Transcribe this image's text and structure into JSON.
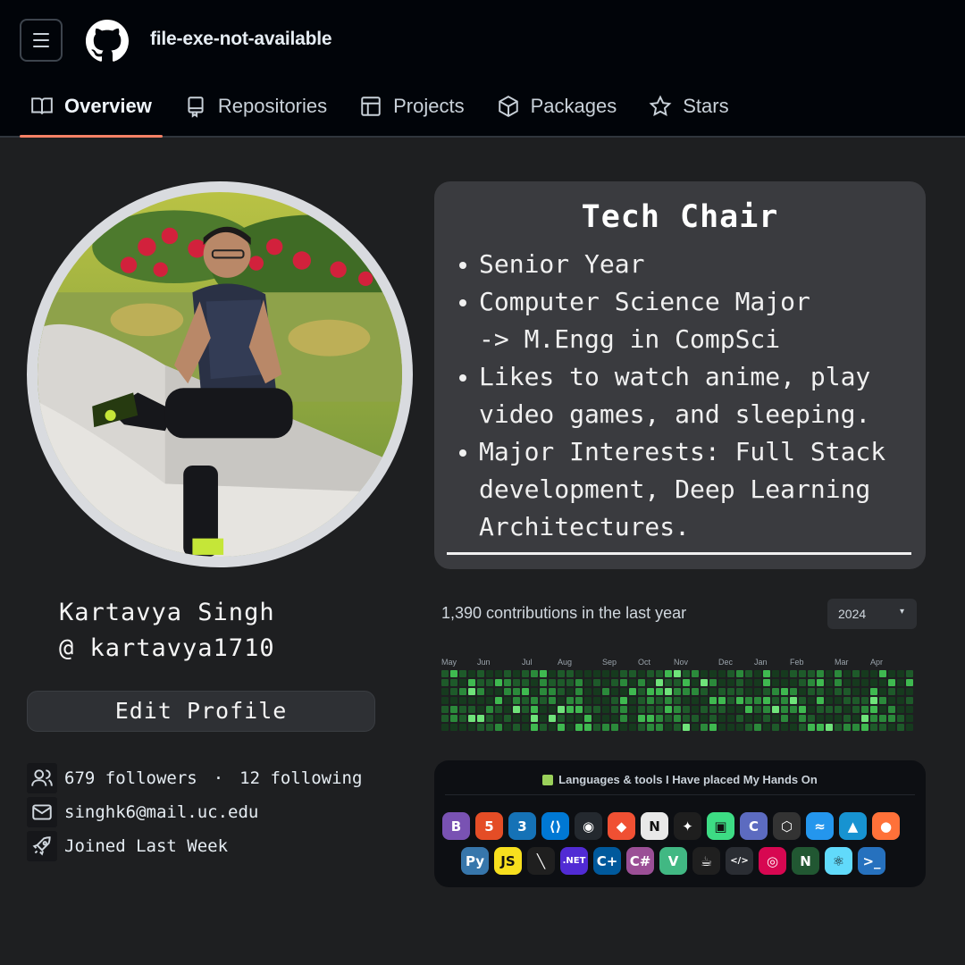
{
  "header": {
    "repo_name": "file-exe-not-available",
    "tabs": [
      {
        "label": "Overview",
        "icon": "book-icon",
        "active": true
      },
      {
        "label": "Repositories",
        "icon": "repo-icon",
        "active": false
      },
      {
        "label": "Projects",
        "icon": "table-icon",
        "active": false
      },
      {
        "label": "Packages",
        "icon": "package-icon",
        "active": false
      },
      {
        "label": "Stars",
        "icon": "star-icon",
        "active": false
      }
    ],
    "accent_color": "#f78166"
  },
  "profile": {
    "name": "Kartavya Singh",
    "handle": "@ kartavya1710",
    "edit_label": "Edit Profile",
    "followers": "679 followers",
    "separator": "·",
    "following": "12 following",
    "email": "singhk6@mail.uc.edu",
    "joined": "Joined Last Week"
  },
  "readme": {
    "title": "Tech Chair",
    "bullets": [
      {
        "lines": [
          "Senior Year"
        ]
      },
      {
        "lines": [
          "Computer Science Major",
          "-> M.Engg in CompSci"
        ]
      },
      {
        "lines": [
          "Likes to watch anime, play",
          "video games, and sleeping."
        ]
      },
      {
        "lines": [
          "Major Interests: Full Stack",
          "development, Deep Learning",
          "Architectures."
        ]
      }
    ]
  },
  "contributions": {
    "title": "1,390 contributions in the last year",
    "year": "2024",
    "months": [
      "May",
      "Jun",
      "Jul",
      "Aug",
      "Sep",
      "Oct",
      "Nov",
      "Dec",
      "Jan",
      "Feb",
      "Mar",
      "Apr"
    ]
  },
  "languages": {
    "title": "Languages & tools I Have placed My Hands On",
    "row1": [
      {
        "name": "bootstrap-icon",
        "glyph": "B",
        "bg": "#7952b3"
      },
      {
        "name": "html5-icon",
        "glyph": "5",
        "bg": "#e44d26"
      },
      {
        "name": "css3-icon",
        "glyph": "3",
        "bg": "#1572b6"
      },
      {
        "name": "vscode-icon",
        "glyph": "⟨⟩",
        "bg": "#0078d4"
      },
      {
        "name": "github-icon",
        "glyph": "◉",
        "bg": "#24292f"
      },
      {
        "name": "git-icon",
        "glyph": "◆",
        "bg": "#f05033"
      },
      {
        "name": "notion-icon",
        "glyph": "N",
        "bg": "#e8e8e8"
      },
      {
        "name": "figma-icon",
        "glyph": "✦",
        "bg": "#1e1e1e"
      },
      {
        "name": "android-studio-icon",
        "glyph": "▣",
        "bg": "#3ddc84"
      },
      {
        "name": "c-icon",
        "glyph": "C",
        "bg": "#5c6bc0"
      },
      {
        "name": "unity-icon",
        "glyph": "⬡",
        "bg": "#333333"
      },
      {
        "name": "docker-icon",
        "glyph": "≈",
        "bg": "#2496ed"
      },
      {
        "name": "arch-icon",
        "glyph": "▲",
        "bg": "#1793d1"
      },
      {
        "name": "firefox-icon",
        "glyph": "●",
        "bg": "#ff7139"
      }
    ],
    "row2": [
      {
        "name": "python-icon",
        "glyph": "Py",
        "bg": "#3776ab"
      },
      {
        "name": "javascript-icon",
        "glyph": "JS",
        "bg": "#f7df1e"
      },
      {
        "name": "vim-icon",
        "glyph": "╲",
        "bg": "#1f1f1f"
      },
      {
        "name": "dotnet-icon",
        "glyph": ".NET",
        "bg": "#512bd4"
      },
      {
        "name": "cpp-icon",
        "glyph": "C+",
        "bg": "#00599c"
      },
      {
        "name": "csharp-icon",
        "glyph": "C#",
        "bg": "#9b4f96"
      },
      {
        "name": "vue-icon",
        "glyph": "V",
        "bg": "#41b883"
      },
      {
        "name": "java-icon",
        "glyph": "☕",
        "bg": "#1f1f1f"
      },
      {
        "name": "code-tag-icon",
        "glyph": "</>",
        "bg": "#2a2d33"
      },
      {
        "name": "debian-icon",
        "glyph": "◎",
        "bg": "#d70751"
      },
      {
        "name": "nodejs-icon",
        "glyph": "N",
        "bg": "#215732"
      },
      {
        "name": "react-icon",
        "glyph": "⚛",
        "bg": "#61dafb"
      },
      {
        "name": "powershell-icon",
        "glyph": ">_",
        "bg": "#2671be"
      }
    ]
  },
  "colors": {
    "contribution_levels": [
      "#163a1e",
      "#1e5a2a",
      "#2b8a3b",
      "#3fb950",
      "#6fe37a"
    ]
  }
}
